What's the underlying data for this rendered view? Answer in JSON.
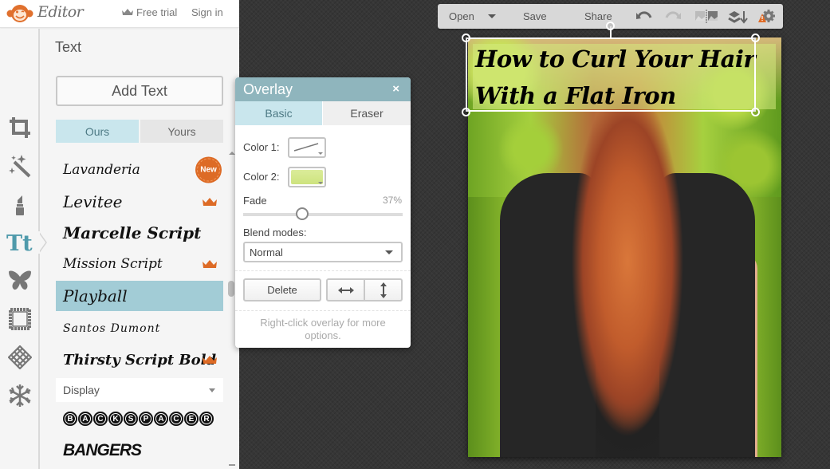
{
  "app": {
    "logo_text": "Editor",
    "free_trial": "Free trial",
    "sign_in": "Sign in"
  },
  "left_panel": {
    "title": "Text",
    "add_text_label": "Add Text",
    "tabs": [
      {
        "label": "Ours",
        "active": true
      },
      {
        "label": "Yours",
        "active": false
      }
    ],
    "tools": [
      {
        "name": "crop",
        "icon": "crop-icon"
      },
      {
        "name": "effects",
        "icon": "magic-wand-icon"
      },
      {
        "name": "touch-up",
        "icon": "lipstick-icon"
      },
      {
        "name": "text",
        "icon": "text-icon",
        "active": true
      },
      {
        "name": "overlays",
        "icon": "butterfly-icon"
      },
      {
        "name": "frames",
        "icon": "frame-icon"
      },
      {
        "name": "textures",
        "icon": "texture-icon"
      },
      {
        "name": "seasonal",
        "icon": "snowflake-icon"
      }
    ],
    "fonts": [
      {
        "name": "Lavanderia",
        "badge": "New"
      },
      {
        "name": "Levitee",
        "premium": true
      },
      {
        "name": "Marcelle Script"
      },
      {
        "name": "Mission Script",
        "premium": true
      },
      {
        "name": "Playball",
        "selected": true
      },
      {
        "name": "Santos Dumont"
      },
      {
        "name": "Thirsty Script Bold",
        "premium": true
      }
    ],
    "category_select": "Display",
    "display_fonts": [
      {
        "name": "BACKSPACER"
      },
      {
        "name": "BANGERS"
      }
    ]
  },
  "overlay_dialog": {
    "title": "Overlay",
    "close_label": "×",
    "tabs": [
      {
        "label": "Basic",
        "active": true
      },
      {
        "label": "Eraser",
        "active": false
      }
    ],
    "color1_label": "Color 1:",
    "color1_value": "none",
    "color2_label": "Color 2:",
    "color2_value": "#d4e98a",
    "fade_label": "Fade",
    "fade_value": "37%",
    "fade_fraction": 0.37,
    "blend_label": "Blend modes:",
    "blend_value": "Normal",
    "delete_label": "Delete",
    "flip_h_icon": "flip-horizontal-icon",
    "flip_v_icon": "flip-vertical-icon",
    "hint": "Right-click overlay for more options."
  },
  "toolbar": {
    "open_label": "Open",
    "save_label": "Save",
    "share_label": "Share",
    "icons": [
      "undo-icon",
      "redo-icon",
      "compare-icon",
      "layers-icon",
      "settings-warning-icon"
    ]
  },
  "canvas": {
    "headline": "How to Curl Your Hair With a Flat Iron"
  },
  "colors": {
    "accent": "#4f9aab",
    "tab_active_bg": "#c9e6ed",
    "selected_font_bg": "#a2ccd6",
    "brand_orange": "#dd6b26",
    "dialog_header": "#8fb5bd"
  }
}
